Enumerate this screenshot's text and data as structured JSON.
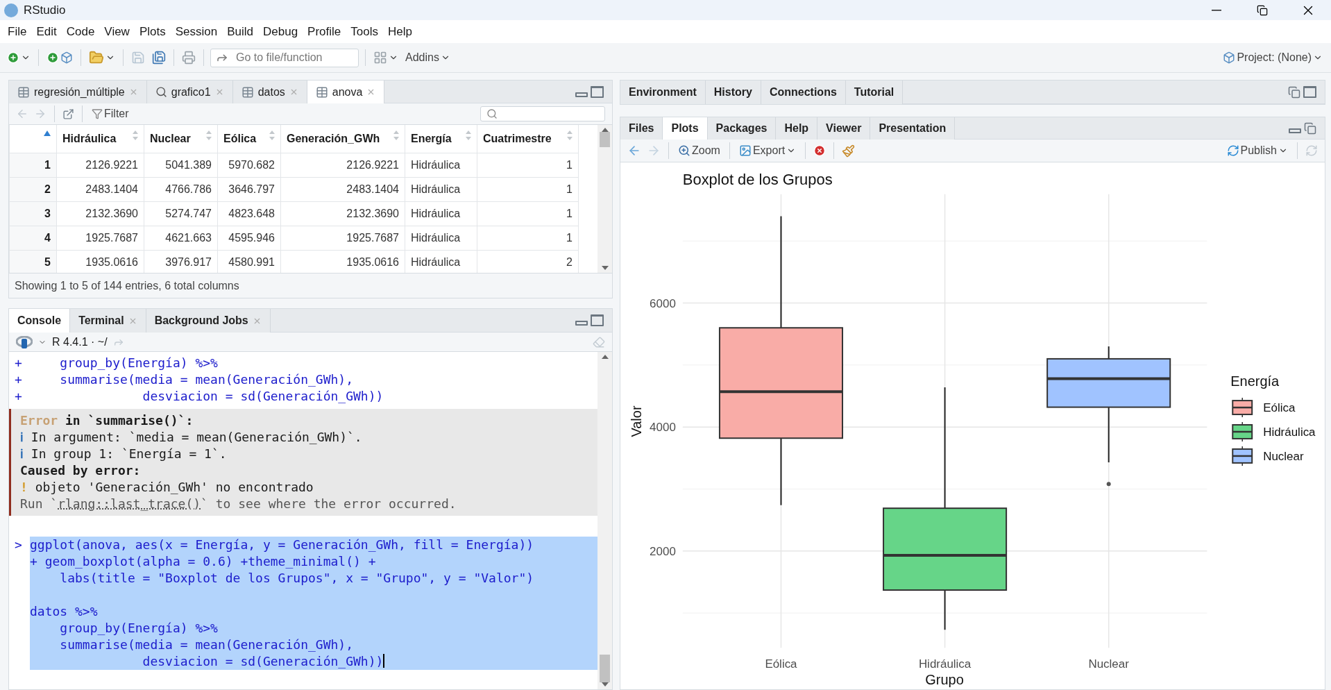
{
  "window": {
    "title": "RStudio"
  },
  "menu": [
    "File",
    "Edit",
    "Code",
    "View",
    "Plots",
    "Session",
    "Build",
    "Debug",
    "Profile",
    "Tools",
    "Help"
  ],
  "toolbar": {
    "goto_placeholder": "Go to file/function",
    "addins": "Addins",
    "project": "Project: (None)"
  },
  "source_pane": {
    "tabs": [
      {
        "label": "regresión_múltiple",
        "kind": "table",
        "selected": false
      },
      {
        "label": "grafico1",
        "kind": "search",
        "selected": false
      },
      {
        "label": "datos",
        "kind": "table",
        "selected": false
      },
      {
        "label": "anova",
        "kind": "table",
        "selected": true
      }
    ],
    "filter": "Filter",
    "table": {
      "columns": [
        {
          "label": "Hidráulica",
          "kind": "number"
        },
        {
          "label": "Nuclear",
          "kind": "number"
        },
        {
          "label": "Eólica",
          "kind": "number"
        },
        {
          "label": "Generación_GWh",
          "kind": "number"
        },
        {
          "label": "Energía",
          "kind": "text"
        },
        {
          "label": "Cuatrimestre",
          "kind": "number"
        }
      ],
      "rows": [
        {
          "index": "1",
          "cells": [
            "2126.9221",
            "5041.389",
            "5970.682",
            "2126.9221",
            "Hidráulica",
            "1"
          ]
        },
        {
          "index": "2",
          "cells": [
            "2483.1404",
            "4766.786",
            "3646.797",
            "2483.1404",
            "Hidráulica",
            "1"
          ]
        },
        {
          "index": "3",
          "cells": [
            "2132.3690",
            "5274.747",
            "4823.648",
            "2132.3690",
            "Hidráulica",
            "1"
          ]
        },
        {
          "index": "4",
          "cells": [
            "1925.7687",
            "4621.663",
            "4595.946",
            "1925.7687",
            "Hidráulica",
            "1"
          ]
        },
        {
          "index": "5",
          "cells": [
            "1935.0616",
            "3976.917",
            "4580.991",
            "1935.0616",
            "Hidráulica",
            "2"
          ]
        }
      ]
    },
    "footer": "Showing 1 to 5 of 144 entries, 6 total columns"
  },
  "console_pane": {
    "tabs": [
      {
        "label": "Console",
        "closable": false,
        "selected": true
      },
      {
        "label": "Terminal",
        "closable": true,
        "selected": false
      },
      {
        "label": "Background Jobs",
        "closable": true,
        "selected": false
      }
    ],
    "version": "R 4.4.1 · ~/",
    "history": [
      {
        "prompt": "+",
        "code": "    group_by(Energía) %>%"
      },
      {
        "prompt": "+",
        "code": "    summarise(media = mean(Generación_GWh),"
      },
      {
        "prompt": "+",
        "code": "               desviacion = sd(Generación_GWh))"
      }
    ],
    "error": [
      {
        "kind": "head",
        "label": "Error",
        "text": "in `summarise()`:"
      },
      {
        "kind": "info",
        "marker": "ℹ",
        "text": "In argument: `media = mean(Generación_GWh)`."
      },
      {
        "kind": "info",
        "marker": "ℹ",
        "text": "In group 1: `Energía = 1`."
      },
      {
        "kind": "heading",
        "text": "Caused by error:"
      },
      {
        "kind": "bang",
        "marker": "!",
        "text": "objeto 'Generación_GWh' no encontrado"
      },
      {
        "kind": "hint",
        "before": "Run `",
        "link": "rlang::last_trace()",
        "after": "` to see where the error occurred."
      }
    ],
    "input": {
      "selected": true,
      "lines": [
        {
          "kind": "code",
          "prompt": ">",
          "code": "ggplot(anova, aes(x = Energía, y = Generación_GWh, fill = Energía))"
        },
        {
          "kind": "code",
          "code": "+ geom_boxplot(alpha = 0.6) +theme_minimal() +"
        },
        {
          "kind": "code",
          "code": "    labs(title = \"Boxplot de los Grupos\", x = \"Grupo\", y = \"Valor\")"
        },
        {
          "kind": "blank"
        },
        {
          "kind": "code",
          "code": "datos %>%"
        },
        {
          "kind": "code",
          "code": "    group_by(Energía) %>%"
        },
        {
          "kind": "code",
          "code": "    summarise(media = mean(Generación_GWh),"
        },
        {
          "kind": "code",
          "code": "               desviacion = sd(Generación_GWh))"
        }
      ]
    }
  },
  "environment_pane": {
    "tabs": [
      {
        "label": "Environment",
        "selected": false
      },
      {
        "label": "History",
        "selected": false
      },
      {
        "label": "Connections",
        "selected": false
      },
      {
        "label": "Tutorial",
        "selected": false
      }
    ]
  },
  "output_pane": {
    "tabs": [
      {
        "label": "Files",
        "selected": false
      },
      {
        "label": "Plots",
        "selected": true
      },
      {
        "label": "Packages",
        "selected": false
      },
      {
        "label": "Help",
        "selected": false
      },
      {
        "label": "Viewer",
        "selected": false
      },
      {
        "label": "Presentation",
        "selected": false
      }
    ],
    "toolbar": {
      "zoom": "Zoom",
      "export": "Export",
      "publish": "Publish"
    },
    "legend": {
      "title": "Energía",
      "items": [
        {
          "label": "Eólica",
          "color": "#f9aca7"
        },
        {
          "label": "Hidráulica",
          "color": "#66d588"
        },
        {
          "label": "Nuclear",
          "color": "#a0c3ff"
        }
      ]
    },
    "plot": {
      "title": "Boxplot de los Grupos",
      "xlabel": "Grupo",
      "ylabel": "Valor",
      "categories": [
        "Eólica",
        "Hidráulica",
        "Nuclear"
      ],
      "yticks": [
        "6000",
        "4000",
        "2000"
      ]
    }
  }
}
